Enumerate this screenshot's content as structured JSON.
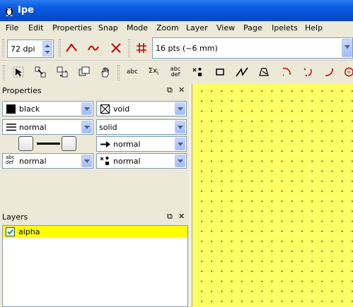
{
  "window": {
    "title": "Ipe"
  },
  "menu": [
    "File",
    "Edit",
    "Properties",
    "Snap",
    "Mode",
    "Zoom",
    "Layer",
    "View",
    "Page",
    "Ipelets",
    "Help"
  ],
  "toolbar": {
    "resolution": "72 dpi",
    "grid_size": "16 pts (~6 mm)"
  },
  "toolbar2": {
    "label_tool": "abc",
    "math_tool": "Σx",
    "math_sub": "i",
    "para_tool_1": "abc",
    "para_tool_2": "def"
  },
  "properties": {
    "title": "Properties",
    "stroke_color": "black",
    "fill_color": "void",
    "pen_width": "normal",
    "dash_style": "solid",
    "arrow": "normal",
    "text_size": "normal",
    "mark_size": "normal",
    "text_icon_top": "abc",
    "text_icon_bottom": "def"
  },
  "layers": {
    "title": "Layers",
    "items": [
      {
        "name": "alpha",
        "checked": true
      }
    ]
  },
  "colors": {
    "title_bar": "#0a5ce0",
    "canvas": "#ffff66",
    "layer_highlight": "#ffff00",
    "tool_red": "#cc0000"
  }
}
